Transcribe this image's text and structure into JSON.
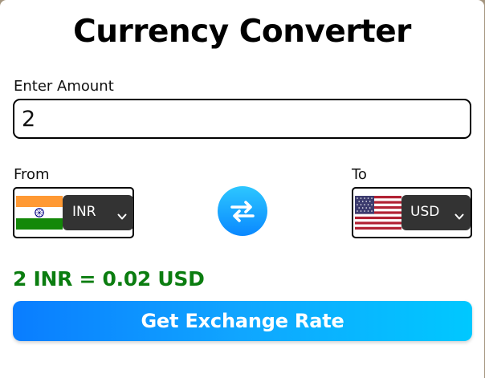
{
  "app": {
    "title": "Currency Converter"
  },
  "amount": {
    "label": "Enter Amount",
    "value": "2"
  },
  "from": {
    "label": "From",
    "currency": "INR",
    "flag": "india-flag-icon"
  },
  "to": {
    "label": "To",
    "currency": "USD",
    "flag": "usa-flag-icon"
  },
  "swap": {
    "icon": "swap-arrows-icon"
  },
  "result": {
    "text": "2 INR = 0.02 USD"
  },
  "action": {
    "button_label": "Get Exchange Rate"
  },
  "colors": {
    "background": "#a59680",
    "card": "#ffffff",
    "result_text": "#0b7d10",
    "select_bg": "#333333",
    "button_gradient_start": "#0a7dff",
    "button_gradient_end": "#00c8ff"
  }
}
